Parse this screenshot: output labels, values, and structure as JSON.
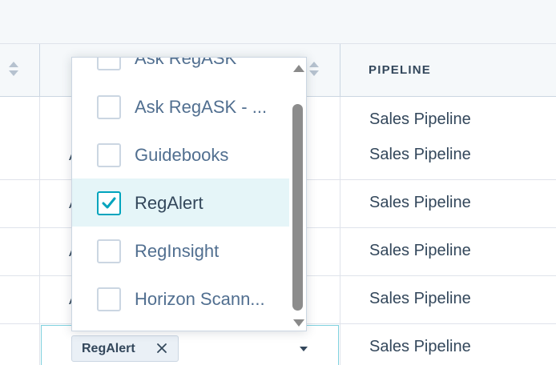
{
  "table": {
    "columns": [
      {
        "label": ""
      },
      {
        "label": ""
      },
      {
        "label": "PIPELINE"
      }
    ],
    "rows": [
      {
        "partial": "",
        "pipeline": "Sales Pipeline"
      },
      {
        "partial": "A",
        "pipeline": "Sales Pipeline"
      },
      {
        "partial": "A",
        "pipeline": "Sales Pipeline"
      },
      {
        "partial": "A",
        "pipeline": "Sales Pipeline"
      },
      {
        "partial": "A",
        "pipeline": "Sales Pipeline"
      }
    ],
    "editing_row": {
      "selected_tag": "RegAlert",
      "pipeline": "Sales Pipeline"
    }
  },
  "dropdown": {
    "options": [
      {
        "label": "Ask RegASK",
        "checked": false
      },
      {
        "label": "Ask RegASK - ...",
        "checked": false
      },
      {
        "label": "Guidebooks",
        "checked": false
      },
      {
        "label": "RegAlert",
        "checked": true
      },
      {
        "label": "RegInsight",
        "checked": false
      },
      {
        "label": "Horizon Scann...",
        "checked": false
      }
    ]
  },
  "colors": {
    "accent": "#00a4bd",
    "selected_bg": "#e5f5f8",
    "header_bg": "#f5f8fa",
    "text": "#33475b"
  }
}
